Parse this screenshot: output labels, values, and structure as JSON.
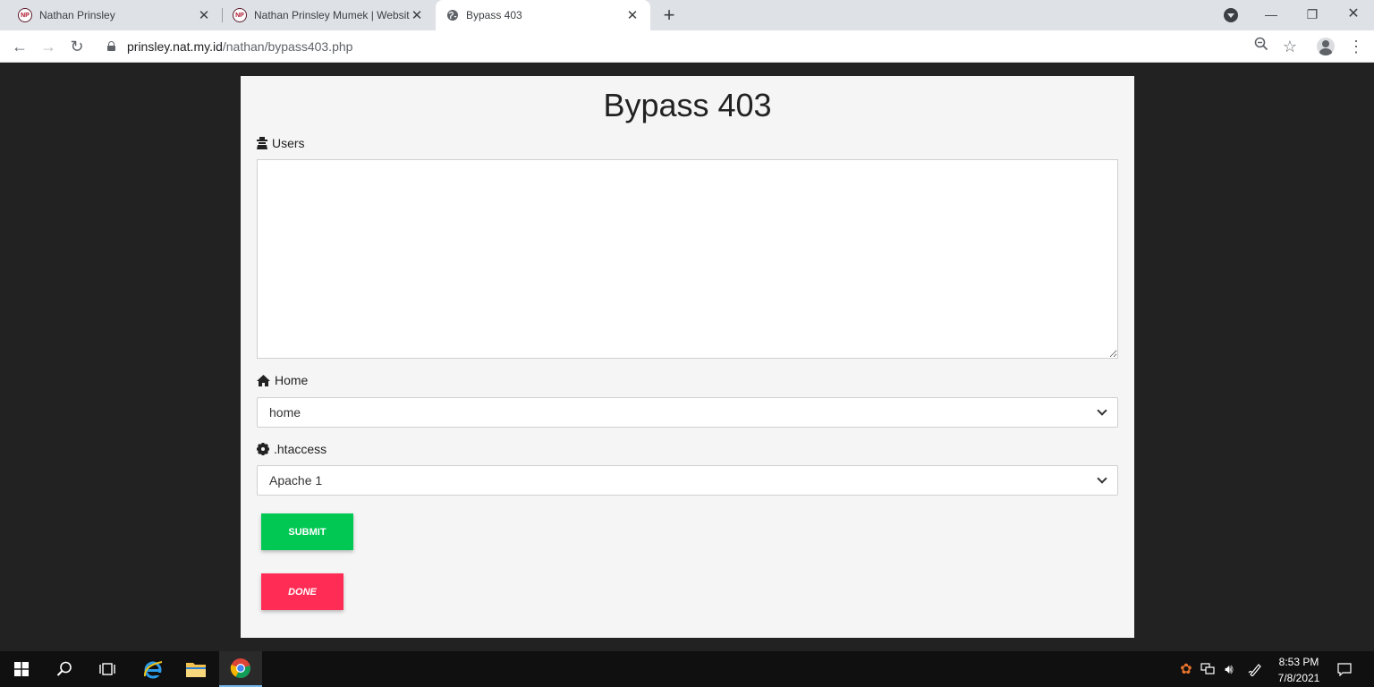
{
  "browser": {
    "tabs": [
      {
        "title": "Nathan Prinsley",
        "favicon": "np-logo-icon"
      },
      {
        "title": "Nathan Prinsley Mumek | Website",
        "favicon": "np-logo-icon"
      },
      {
        "title": "Bypass 403",
        "favicon": "globe-icon"
      }
    ],
    "url_host": "prinsley.nat.my.id",
    "url_path": "/nathan/bypass403.php"
  },
  "page": {
    "title": "Bypass 403",
    "users_label": "Users",
    "users_value": "",
    "home_label": "Home",
    "home_selected": "home",
    "htaccess_label": ".htaccess",
    "htaccess_selected": "Apache 1",
    "submit_label": "SUBMIT",
    "done_label": "DONE",
    "colors": {
      "submit": "#00c853",
      "done": "#ff2d55",
      "background": "#222222",
      "card": "#f5f5f5"
    }
  },
  "taskbar": {
    "time": "8:53 PM",
    "date": "7/8/2021"
  }
}
